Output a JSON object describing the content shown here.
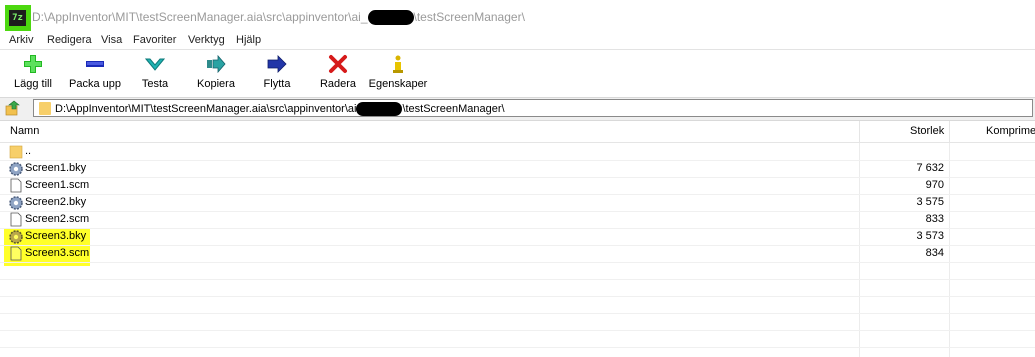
{
  "window": {
    "title_prefix": "D:\\AppInventor\\MIT\\testScreenManager.aia\\src\\appinventor\\ai_",
    "title_suffix": "\\testScreenManager\\",
    "app_icon_text": "7z"
  },
  "menu": [
    "Arkiv",
    "Redigera",
    "Visa",
    "Favoriter",
    "Verktyg",
    "Hjälp"
  ],
  "toolbar": [
    {
      "label": "Lägg till",
      "icon": "plus-icon"
    },
    {
      "label": "Packa upp",
      "icon": "minus-icon"
    },
    {
      "label": "Testa",
      "icon": "check-icon"
    },
    {
      "label": "Kopiera",
      "icon": "copy-arrow-icon"
    },
    {
      "label": "Flytta",
      "icon": "move-arrow-icon"
    },
    {
      "label": "Radera",
      "icon": "delete-x-icon"
    },
    {
      "label": "Egenskaper",
      "icon": "info-icon"
    }
  ],
  "address": {
    "prefix": "D:\\AppInventor\\MIT\\testScreenManager.aia\\src\\appinventor\\ai",
    "suffix": "\\testScreenManager\\"
  },
  "columns": {
    "name": "Namn",
    "size": "Storlek",
    "compressed": "Komprime"
  },
  "files": [
    {
      "name": "..",
      "size": "",
      "type": "folder",
      "highlighted": false
    },
    {
      "name": "Screen1.bky",
      "size": "7 632",
      "type": "bky",
      "highlighted": false
    },
    {
      "name": "Screen1.scm",
      "size": "970",
      "type": "scm",
      "highlighted": false
    },
    {
      "name": "Screen2.bky",
      "size": "3 575",
      "type": "bky",
      "highlighted": false
    },
    {
      "name": "Screen2.scm",
      "size": "833",
      "type": "scm",
      "highlighted": false
    },
    {
      "name": "Screen3.bky",
      "size": "3 573",
      "type": "bky",
      "highlighted": true
    },
    {
      "name": "Screen3.scm",
      "size": "834",
      "type": "scm",
      "highlighted": true
    }
  ],
  "colors": {
    "highlight": "#ffff00",
    "app_icon": "#4cd80f"
  }
}
